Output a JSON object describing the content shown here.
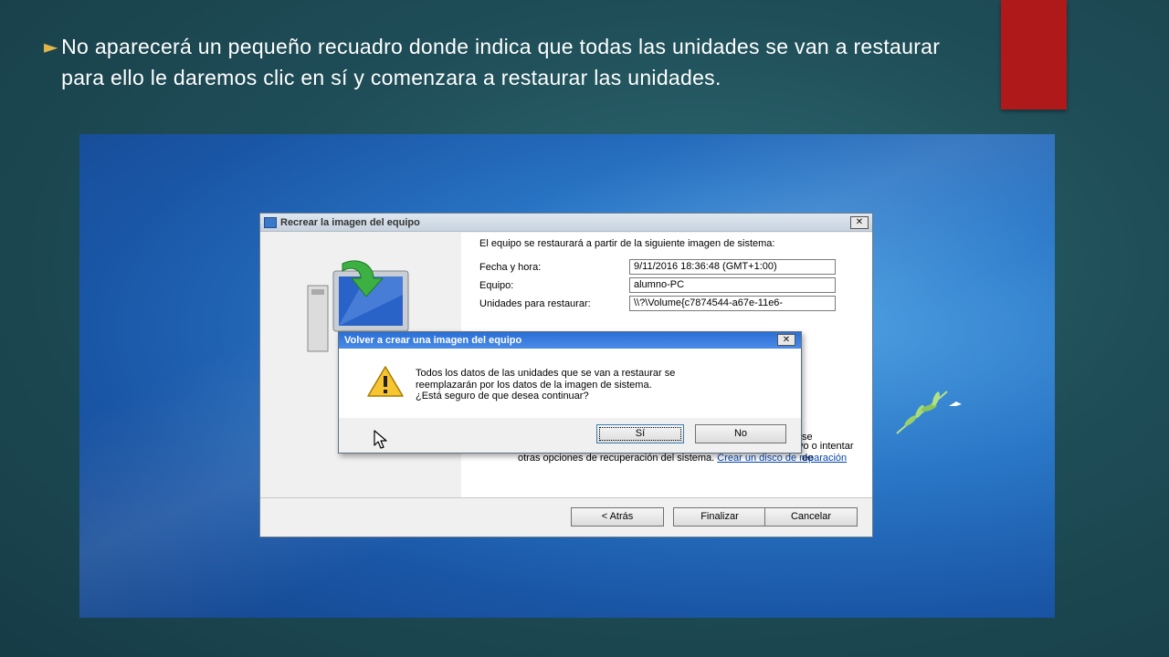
{
  "slide": {
    "bullet_glyph": "►",
    "text": "No aparecerá un pequeño recuadro donde indica que todas las unidades se van a restaurar para ello le daremos clic en sí y comenzara a restaurar las unidades.",
    "accent_color": "#b01919"
  },
  "wizard": {
    "title": "Recrear la imagen del equipo",
    "intro": "El equipo se restaurará a partir de la siguiente imagen de sistema:",
    "fields": [
      {
        "label": "Fecha y hora:",
        "value": "9/11/2016 18:36:48 (GMT+1:00)"
      },
      {
        "label": "Equipo:",
        "value": "alumno-PC"
      },
      {
        "label": "Unidades para restaurar:",
        "value": "\\\\?\\Volume{c7874544-a67e-11e6-"
      }
    ],
    "hidden_fragments": [
      "se",
      "de"
    ],
    "lower_text": "reparación del sistema para intentar restaurar el equipo de nuevo o intentar otras opciones de recuperación del sistema.",
    "link": "Crear un disco de reparación",
    "buttons": {
      "back": "< Atrás",
      "finish": "Finalizar",
      "cancel": "Cancelar"
    }
  },
  "dialog": {
    "title": "Volver a crear una imagen del equipo",
    "message_lines": [
      "Todos los datos de las unidades que se van a restaurar se",
      "reemplazarán por los datos de la imagen de sistema.",
      "¿Está seguro de que desea continuar?"
    ],
    "buttons": {
      "yes": "Sí",
      "no": "No"
    }
  }
}
